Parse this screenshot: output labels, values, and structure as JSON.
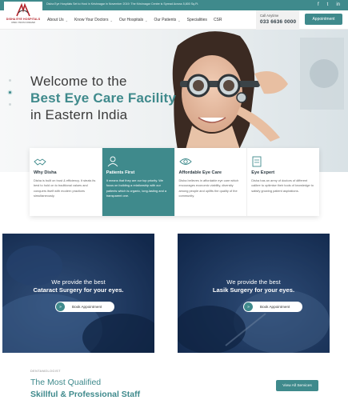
{
  "topbar": {
    "news": "Disha Eye Hospitals Set to Host in Krishnagar in November 2019: The Krishnagar Centre is Spread Across 5,800 Sq.Ft.",
    "social": [
      "f",
      "t",
      "in"
    ]
  },
  "logo": {
    "name": "DISHA EYE HOSPITALS",
    "tagline": "OPEN VISION FOREVER"
  },
  "nav": {
    "items": [
      {
        "label": "About Us",
        "has_dropdown": true
      },
      {
        "label": "Know Your Doctors",
        "has_dropdown": true
      },
      {
        "label": "Our Hospitals",
        "has_dropdown": true
      },
      {
        "label": "Our Patients",
        "has_dropdown": true
      },
      {
        "label": "Specialities",
        "has_dropdown": false
      },
      {
        "label": "CSR",
        "has_dropdown": false
      }
    ],
    "call_label": "Call Anytime",
    "call_number": "033 6636 0000",
    "appointment_label": "Appointment"
  },
  "hero": {
    "line1": "Welcome to the",
    "line2": "Best Eye Care Facility",
    "line3": "in Eastern India"
  },
  "features": [
    {
      "title": "Why Disha",
      "icon": "handshake-icon",
      "desc": "Disha is built on trust & efficiency. It steals its best to hold on to traditional values and conquers itself with modern practices simultaneously.",
      "active": false
    },
    {
      "title": "Patients First",
      "icon": "patient-icon",
      "desc": "It means that they are our top priority. We focus on building a relationship with our patients which is organic, long-lasting and a transparent one.",
      "active": true
    },
    {
      "title": "Affordable Eye Care",
      "icon": "eye-icon",
      "desc": "Disha believes in affordable eye care which encourages economic viability, diversity among people and uplifts the quality of the community.",
      "active": false
    },
    {
      "title": "Eye Expert",
      "icon": "document-icon",
      "desc": "Disha has an army of doctors of different calibre to optimise their tools of knowledge to satisfy growing patient aspirations.",
      "active": false
    }
  ],
  "panels": [
    {
      "line1": "We provide the best",
      "line2": "Cataract Surgery for your eyes.",
      "button": "Book Appointment"
    },
    {
      "line1": "We provide the best",
      "line2": "Lasik Surgery for your eyes.",
      "button": "Book Appointment"
    }
  ],
  "staff": {
    "eyebrow": "DENTAMOLOGIST",
    "title1": "The Most Qualified",
    "title2": "Skillful & Professional Staff",
    "view_all": "View All Services"
  },
  "colors": {
    "accent": "#3f8a8c",
    "panel_bg": "#1d3c68",
    "logo_red": "#b4252c"
  }
}
